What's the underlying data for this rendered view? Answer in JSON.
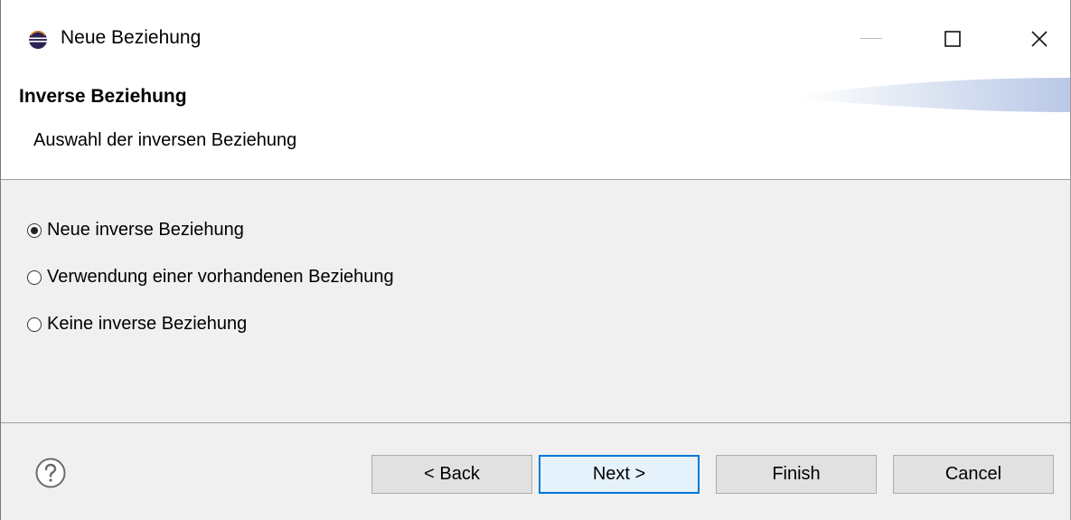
{
  "window": {
    "title": "Neue Beziehung"
  },
  "banner": {
    "title": "Inverse Beziehung",
    "description": "Auswahl der inversen Beziehung"
  },
  "options": {
    "items": [
      {
        "label": "Neue inverse Beziehung",
        "selected": true
      },
      {
        "label": "Verwendung einer vorhandenen Beziehung",
        "selected": false
      },
      {
        "label": "Keine inverse Beziehung",
        "selected": false
      }
    ]
  },
  "buttons": {
    "back": "< Back",
    "next": "Next >",
    "finish": "Finish",
    "cancel": "Cancel"
  },
  "colors": {
    "default_button_border": "#0078d7",
    "dialog_background": "#f0f0f0"
  },
  "icons": {
    "app": "eclipse-icon",
    "minimize": "minimize-icon",
    "maximize": "maximize-icon",
    "close": "close-icon",
    "help": "help-icon"
  }
}
